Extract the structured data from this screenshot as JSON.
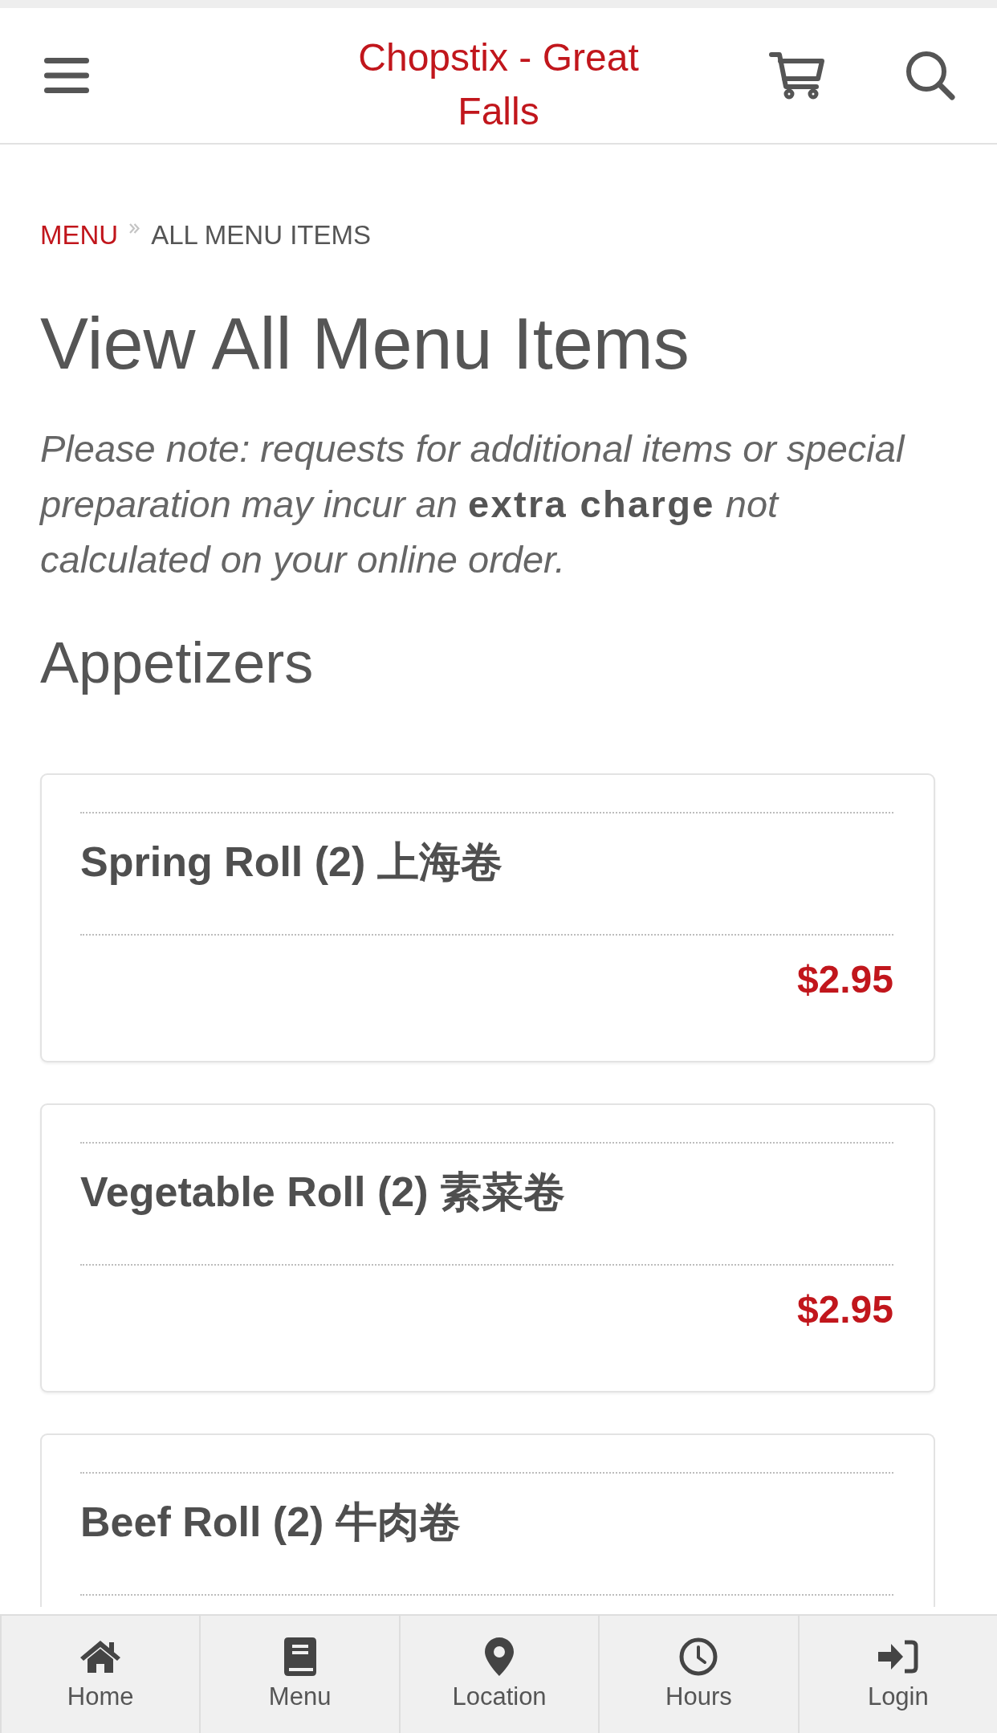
{
  "header": {
    "title": "Chopstix - Great Falls"
  },
  "breadcrumb": [
    {
      "label": "MENU",
      "kind": "link"
    },
    {
      "label": "ALL MENU ITEMS",
      "kind": "current"
    }
  ],
  "page": {
    "title": "View All Menu Items",
    "note": "Please note: requests for additional items or special preparation may incur an **extra charge** not calculated on your online order."
  },
  "sections": [
    {
      "heading": "Appetizers",
      "items": [
        {
          "name": "Spring Roll (2) 上海卷",
          "price": "$2.95"
        },
        {
          "name": "Vegetable Roll (2) 素菜卷",
          "price": "$2.95"
        },
        {
          "name": "Beef Roll (2) 牛肉卷"
        }
      ]
    }
  ],
  "bottom_nav": [
    {
      "label": "Home",
      "selected": false
    },
    {
      "label": "Menu",
      "selected": false
    },
    {
      "label": "Location",
      "selected": false
    },
    {
      "label": "Hours",
      "selected": false
    },
    {
      "label": "Login",
      "selected": false
    }
  ]
}
